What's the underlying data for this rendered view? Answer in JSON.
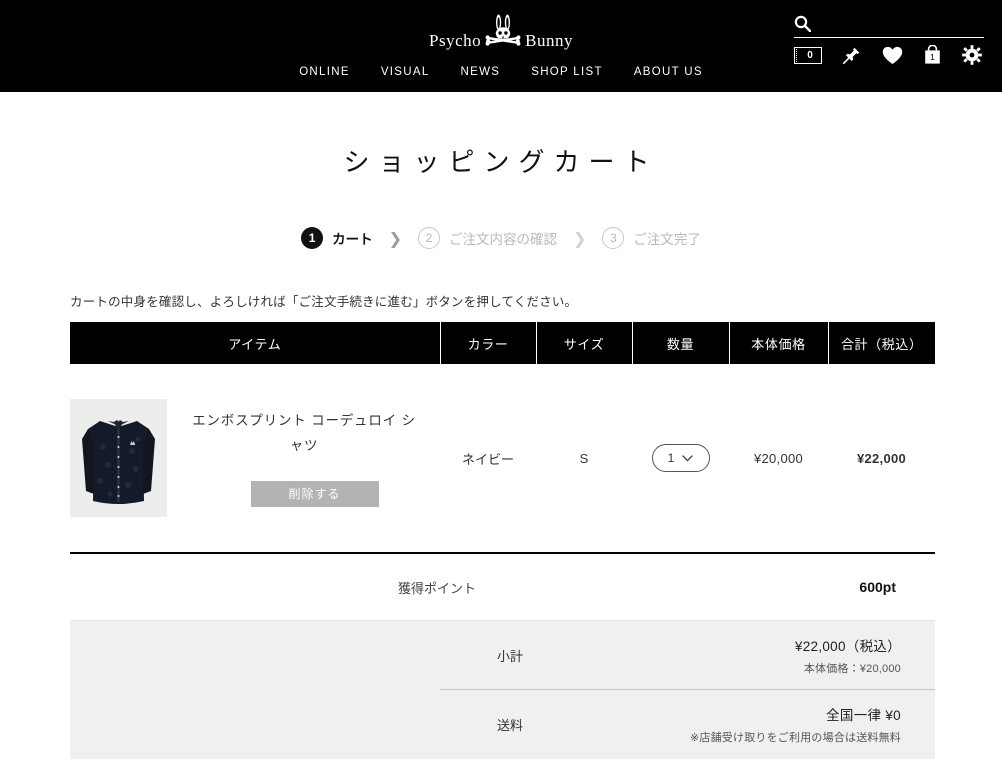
{
  "header": {
    "logo": {
      "left_word": "Psycho",
      "right_word": "Bunny",
      "mark": "bunny-skull-crossbones-icon"
    },
    "nav": [
      {
        "label": "ONLINE"
      },
      {
        "label": "VISUAL"
      },
      {
        "label": "NEWS"
      },
      {
        "label": "SHOP LIST"
      },
      {
        "label": "ABOUT US"
      }
    ],
    "search": {
      "placeholder": "",
      "value": "",
      "icon": "search-icon"
    },
    "tools": {
      "coupon_count": "0",
      "coupon_icon": "ticket-icon",
      "pin_icon": "pin-icon",
      "wishlist_icon": "heart-icon",
      "cart_icon": "shopping-bag-icon",
      "cart_count": "1",
      "settings_icon": "gear-icon"
    }
  },
  "page": {
    "title": "ショッピングカート",
    "notice": "カートの中身を確認し、よろしければ「ご注文手続きに進む」ボタンを押してください。"
  },
  "steps": [
    {
      "num": "1",
      "label": "カート",
      "state": "active"
    },
    {
      "num": "2",
      "label": "ご注文内容の確認",
      "state": "inactive"
    },
    {
      "num": "3",
      "label": "ご注文完了",
      "state": "inactive"
    }
  ],
  "step_separator": "❯",
  "cart": {
    "columns": [
      {
        "key": "item",
        "label": "アイテム"
      },
      {
        "key": "color",
        "label": "カラー"
      },
      {
        "key": "size",
        "label": "サイズ"
      },
      {
        "key": "qty",
        "label": "数量"
      },
      {
        "key": "price",
        "label": "本体価格"
      },
      {
        "key": "total",
        "label": "合計（税込）"
      }
    ],
    "rows": [
      {
        "name": "エンボスプリント コーデュロイ シャツ",
        "delete_label": "削除する",
        "color": "ネイビー",
        "size": "S",
        "qty": "1",
        "price": "¥20,000",
        "total": "¥22,000",
        "thumb_alt": "navy-corduroy-shirt-thumbnail"
      }
    ]
  },
  "points": {
    "label": "獲得ポイント",
    "value": "600pt"
  },
  "summary": [
    {
      "label": "小計",
      "main": "¥22,000（税込）",
      "sub": "本体価格：¥20,000"
    },
    {
      "label": "送料",
      "main": "全国一律 ¥0",
      "sub": "※店舗受け取りをご利用の場合は送料無料"
    }
  ],
  "colors": {
    "header_bg": "#000000",
    "accent": "#000000",
    "summary_bg": "#f0f0f0",
    "delete_btn": "#b3b3b3",
    "muted_text": "#b9b9b9"
  }
}
